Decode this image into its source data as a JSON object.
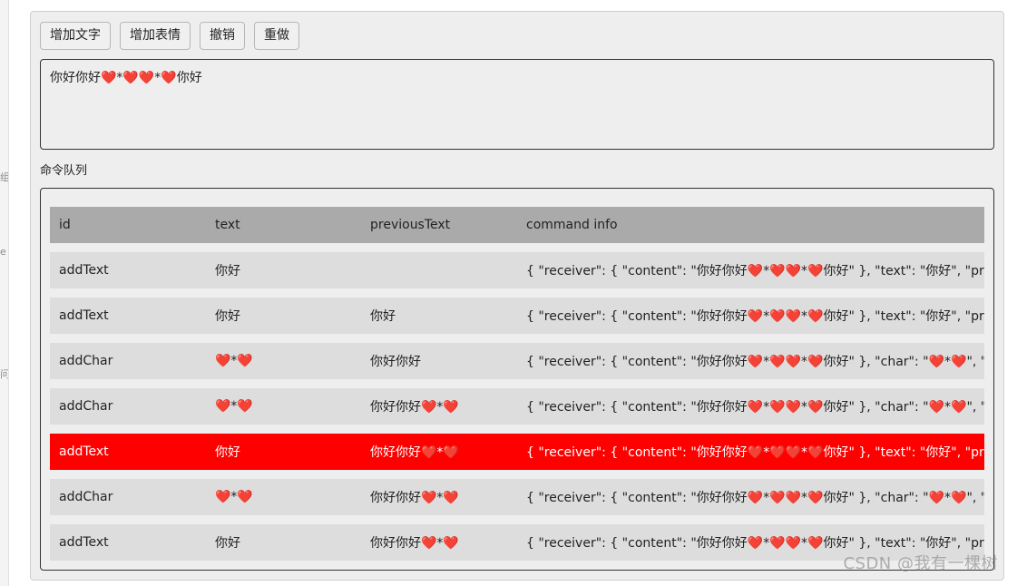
{
  "edge": {
    "glyphs": [
      "组",
      "e",
      "问"
    ]
  },
  "toolbar": {
    "buttons": [
      {
        "label": "增加文字"
      },
      {
        "label": "增加表情"
      },
      {
        "label": "撤销"
      },
      {
        "label": "重做"
      }
    ]
  },
  "editor": {
    "content": "你好你好❤️*❤️❤️*❤️你好"
  },
  "queue": {
    "label": "命令队列",
    "columns": {
      "id": "id",
      "text": "text",
      "previousText": "previousText",
      "info": "command info"
    },
    "rows": [
      {
        "id": "addText",
        "text": "你好",
        "previousText": "",
        "info": "{ \"receiver\": { \"content\": \"你好你好❤️*❤️❤️*❤️你好\" }, \"text\": \"你好\", \"previousText\""
      },
      {
        "id": "addText",
        "text": "你好",
        "previousText": "你好",
        "info": "{ \"receiver\": { \"content\": \"你好你好❤️*❤️❤️*❤️你好\" }, \"text\": \"你好\", \"previousText\""
      },
      {
        "id": "addChar",
        "text": "❤️*❤️",
        "previousText": "你好你好",
        "info": "{ \"receiver\": { \"content\": \"你好你好❤️*❤️❤️*❤️你好\" }, \"char\": \"❤️*❤️\", \"previousText\""
      },
      {
        "id": "addChar",
        "text": "❤️*❤️",
        "previousText": "你好你好❤️*❤️",
        "info": "{ \"receiver\": { \"content\": \"你好你好❤️*❤️❤️*❤️你好\" }, \"char\": \"❤️*❤️\", \"previousText\""
      },
      {
        "id": "addText",
        "text": "你好",
        "previousText": "你好你好❤️*❤️",
        "info": "{ \"receiver\": { \"content\": \"你好你好❤️*❤️❤️*❤️你好\" }, \"text\": \"你好\", \"previousText\"",
        "selected": true
      },
      {
        "id": "addChar",
        "text": "❤️*❤️",
        "previousText": "你好你好❤️*❤️",
        "info": "{ \"receiver\": { \"content\": \"你好你好❤️*❤️❤️*❤️你好\" }, \"char\": \"❤️*❤️\", \"previousText\""
      },
      {
        "id": "addText",
        "text": "你好",
        "previousText": "你好你好❤️*❤️",
        "info": "{ \"receiver\": { \"content\": \"你好你好❤️*❤️❤️*❤️你好\" }, \"text\": \"你好\", \"previousText\""
      }
    ]
  },
  "colors": {
    "selected_row": "#ff0000",
    "header_row": "#aaaaaa",
    "row": "#dddddd",
    "panel": "#eeeeee"
  },
  "watermark": "CSDN @我有一棵树"
}
